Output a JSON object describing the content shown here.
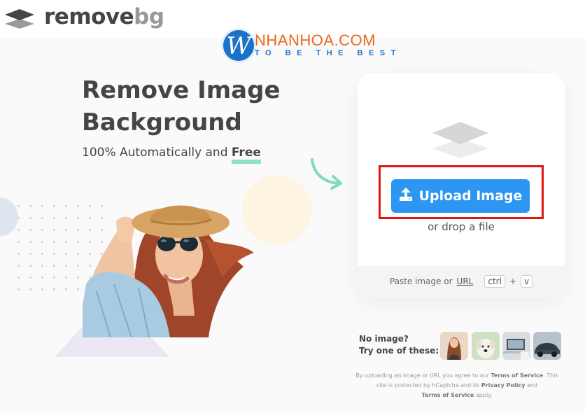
{
  "header": {
    "logo_word1": "remove",
    "logo_word2": "bg"
  },
  "watermark": {
    "letter": "W",
    "name": "NHANHOA.COM",
    "tagline": "TO BE THE BEST"
  },
  "hero": {
    "title": "Remove Image Background",
    "subtitle_prefix": "100% Automatically and ",
    "subtitle_free": "Free"
  },
  "upload": {
    "button_label": "Upload Image",
    "button_icon": "upload-icon",
    "drop_text": "or drop a file",
    "paste_prefix": "Paste image or",
    "paste_url": "URL",
    "key_ctrl": "ctrl",
    "key_plus": "+",
    "key_v": "v"
  },
  "samples": {
    "line1": "No image?",
    "line2": "Try one of these:",
    "items": [
      "sample-woman",
      "sample-dog",
      "sample-laptop",
      "sample-car"
    ]
  },
  "disclaimer": {
    "t1": "By uploading an image or URL you agree to our ",
    "tos1": "Terms of Service",
    "t2": ". This site is protected by hCaptcha and its ",
    "privacy": "Privacy Policy",
    "t3": " and ",
    "tos2": "Terms of Service",
    "t4": " apply."
  },
  "colors": {
    "accent": "#2d95f2",
    "highlight": "#e11414",
    "free_underline": "#8ee2c0"
  }
}
